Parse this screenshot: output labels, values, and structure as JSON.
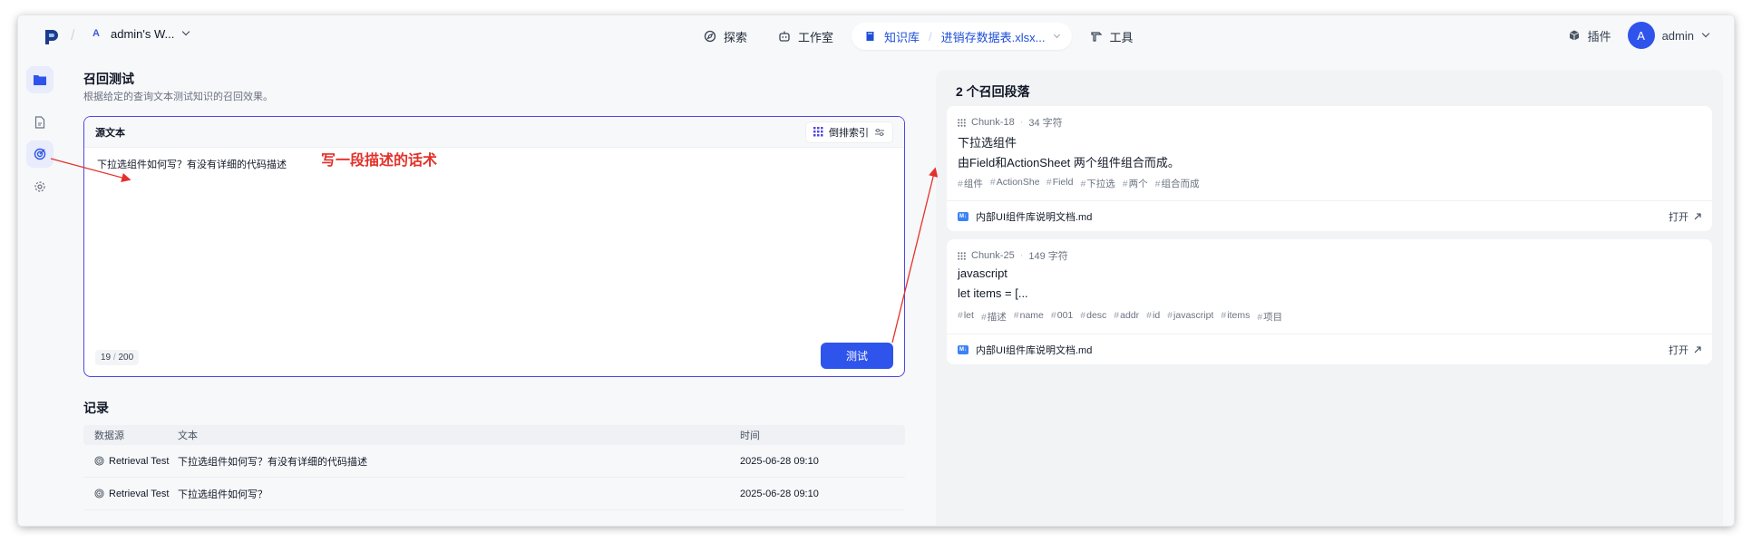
{
  "workspace": {
    "badge": "A",
    "name": "admin's W..."
  },
  "nav": {
    "explore": "探索",
    "studio": "工作室",
    "knowledge": "知识库",
    "dataset": "进销存数据表.xlsx...",
    "tools": "工具"
  },
  "right_nav": {
    "plugins": "插件",
    "avatar": "A",
    "user": "admin"
  },
  "page": {
    "title": "召回测试",
    "subtitle": "根据给定的查询文本测试知识的召回效果。"
  },
  "source": {
    "label": "源文本",
    "index_mode": "倒排索引",
    "text": "下拉选组件如何写？有没有详细的代码描述",
    "count": "19",
    "max": "200",
    "test_button": "测试"
  },
  "annotation": "写一段描述的话术",
  "records": {
    "title": "记录",
    "columns": {
      "source": "数据源",
      "text": "文本",
      "time": "时间"
    },
    "rows": [
      {
        "source": "Retrieval Test",
        "text": "下拉选组件如何写？有没有详细的代码描述",
        "time": "2025-06-28 09:10"
      },
      {
        "source": "Retrieval Test",
        "text": "下拉选组件如何写？",
        "time": "2025-06-28 09:10"
      }
    ]
  },
  "results": {
    "title": "2 个召回段落",
    "cards": [
      {
        "chunk": "Chunk-18",
        "chars": "34 字符",
        "line1": "下拉选组件",
        "line2": "由Field和ActionSheet 两个组件组合而成。",
        "tags": [
          "组件",
          "ActionSheet",
          "Field",
          "下拉选",
          "两个",
          "组合而成"
        ],
        "file": "内部UI组件库说明文档.md",
        "open": "打开"
      },
      {
        "chunk": "Chunk-25",
        "chars": "149 字符",
        "line1": "javascript",
        "line2": "let items = [...",
        "tags": [
          "let",
          "描述",
          "name",
          "001",
          "desc",
          "addr",
          "id",
          "javascript",
          "items",
          "项目"
        ],
        "file": "内部UI组件库说明文档.md",
        "open": "打开"
      }
    ]
  },
  "colors": {
    "accent": "#2f54eb",
    "annotation": "#e4312b"
  }
}
